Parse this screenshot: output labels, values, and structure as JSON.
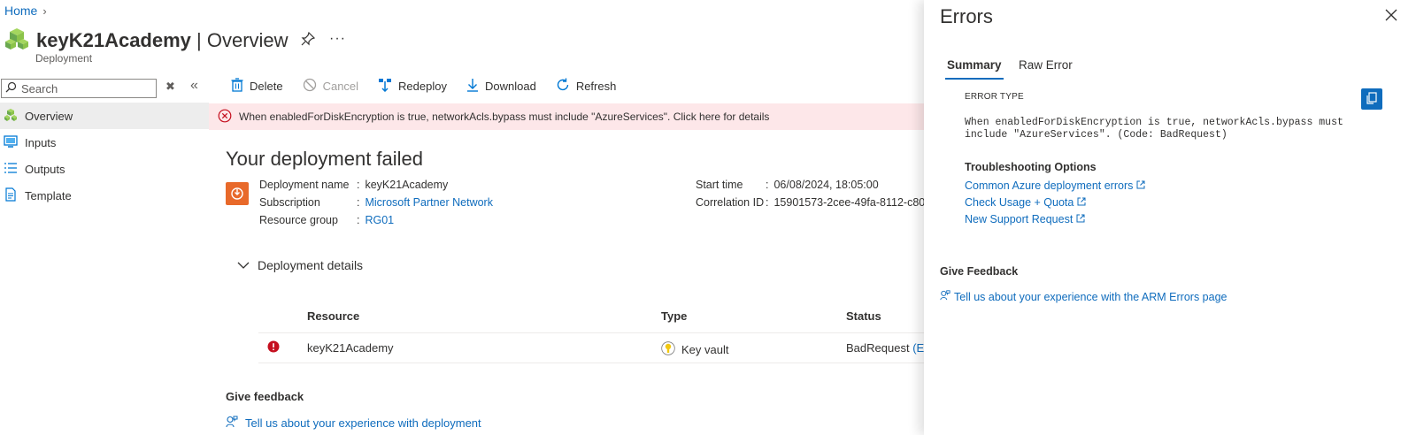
{
  "breadcrumb": {
    "home": "Home"
  },
  "header": {
    "resource_name": "keyK21Academy",
    "separator": " | ",
    "view": "Overview",
    "subtitle": "Deployment"
  },
  "sidebar": {
    "search_placeholder": "Search",
    "items": [
      {
        "label": "Overview",
        "icon": "overview-icon",
        "active": true
      },
      {
        "label": "Inputs",
        "icon": "inputs-icon",
        "active": false
      },
      {
        "label": "Outputs",
        "icon": "outputs-icon",
        "active": false
      },
      {
        "label": "Template",
        "icon": "template-icon",
        "active": false
      }
    ]
  },
  "toolbar": {
    "delete": "Delete",
    "cancel": "Cancel",
    "redeploy": "Redeploy",
    "download": "Download",
    "refresh": "Refresh"
  },
  "banner": {
    "message": "When enabledForDiskEncryption is true, networkAcls.bypass must include \"AzureServices\". Click here for details"
  },
  "main": {
    "title": "Your deployment failed",
    "info_left": [
      {
        "key": "Deployment name",
        "value": "keyK21Academy",
        "link": false
      },
      {
        "key": "Subscription",
        "value": "Microsoft Partner Network",
        "link": true
      },
      {
        "key": "Resource group",
        "value": "RG01",
        "link": true
      }
    ],
    "info_right": [
      {
        "key": "Start time",
        "value": "06/08/2024, 18:05:00"
      },
      {
        "key": "Correlation ID",
        "value": "15901573-2cee-49fa-8112-c80"
      }
    ],
    "details_toggle": "Deployment details",
    "table": {
      "headers": [
        "Resource",
        "Type",
        "Status"
      ],
      "rows": [
        {
          "resource": "keyK21Academy",
          "type": "Key vault",
          "status": "BadRequest",
          "status_link": "(Err"
        }
      ]
    },
    "give_feedback": "Give feedback",
    "feedback_link": "Tell us about your experience with deployment"
  },
  "panel": {
    "title": "Errors",
    "tabs": [
      "Summary",
      "Raw Error"
    ],
    "error_type_label": "ERROR TYPE",
    "error_message": "When enabledForDiskEncryption is true, networkAcls.bypass must include \"AzureServices\". (Code: BadRequest)",
    "troubleshooting_title": "Troubleshooting Options",
    "troubleshooting_links": [
      "Common Azure deployment errors",
      "Check Usage + Quota",
      "New Support Request"
    ],
    "feedback_title": "Give Feedback",
    "feedback_link": "Tell us about your experience with the ARM Errors page"
  },
  "colors": {
    "accent": "#0f6cbd",
    "error": "#c50f1f",
    "banner_bg": "#fde7e9",
    "deployment_icon": "#e8692a"
  }
}
